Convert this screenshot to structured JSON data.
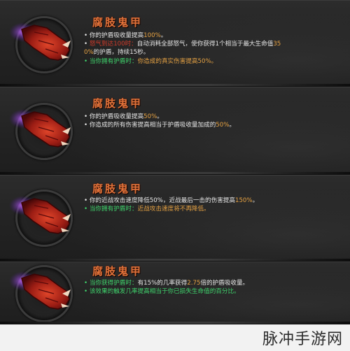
{
  "watermark": "脉冲手游网",
  "cards": [
    {
      "icon": "demon-gauntlet-icon",
      "name": "腐肢鬼甲",
      "lines": [
        [
          {
            "t": "• ",
            "c": "bullet"
          },
          {
            "t": "你的护盾吸收量提高",
            "c": "white"
          },
          {
            "t": "100%",
            "c": "orange"
          },
          {
            "t": "。",
            "c": "white"
          }
        ],
        [
          {
            "t": "• ",
            "c": "bullet"
          },
          {
            "t": "怒气到达100时：",
            "c": "red"
          },
          {
            "t": "自动消耗全部怒气，使你获得1个相当于最大生命值",
            "c": "white"
          },
          {
            "t": "35",
            "c": "orange"
          }
        ],
        [
          {
            "t": "0%",
            "c": "orange"
          },
          {
            "t": "的护盾，持续15秒。",
            "c": "white"
          }
        ],
        [
          {
            "t": "• ",
            "c": "green"
          },
          {
            "t": "当你拥有护盾时：",
            "c": "green"
          },
          {
            "t": "你造成的真实伤害提高50%。",
            "c": "orange"
          }
        ]
      ]
    },
    {
      "icon": "demon-gauntlet-icon",
      "name": "腐肢鬼甲",
      "lines": [
        [
          {
            "t": "• ",
            "c": "bullet"
          },
          {
            "t": "你的护盾吸收量提高",
            "c": "white"
          },
          {
            "t": "50%",
            "c": "orange"
          },
          {
            "t": "。",
            "c": "white"
          }
        ],
        [
          {
            "t": "• ",
            "c": "bullet"
          },
          {
            "t": "你造成的所有伤害提高相当于护盾吸收量加成的",
            "c": "white"
          },
          {
            "t": "50%",
            "c": "orange"
          },
          {
            "t": "。",
            "c": "white"
          }
        ]
      ]
    },
    {
      "icon": "demon-gauntlet-icon",
      "name": "腐肢鬼甲",
      "lines": [
        [
          {
            "t": "• ",
            "c": "bullet"
          },
          {
            "t": "你的近战攻击速度降低50%，近战最后一击的伤害提高",
            "c": "white"
          },
          {
            "t": "150%",
            "c": "orange"
          },
          {
            "t": "。",
            "c": "white"
          }
        ],
        [
          {
            "t": "• ",
            "c": "green"
          },
          {
            "t": "当你拥有护盾时：",
            "c": "green"
          },
          {
            "t": "近战攻击速度将不再降低。",
            "c": "orange"
          }
        ]
      ]
    },
    {
      "icon": "demon-gauntlet-icon",
      "name": "腐肢鬼甲",
      "lines": [
        [
          {
            "t": "• ",
            "c": "green"
          },
          {
            "t": "当你获得护盾时：",
            "c": "green"
          },
          {
            "t": "有15%的几率获得",
            "c": "white"
          },
          {
            "t": "2.75",
            "c": "orange"
          },
          {
            "t": "倍的护盾吸收量。",
            "c": "white"
          }
        ],
        [
          {
            "t": "• ",
            "c": "green"
          },
          {
            "t": "该效果的触发几率提高相当于你已损失生命值的百分比。",
            "c": "green"
          }
        ]
      ]
    }
  ]
}
